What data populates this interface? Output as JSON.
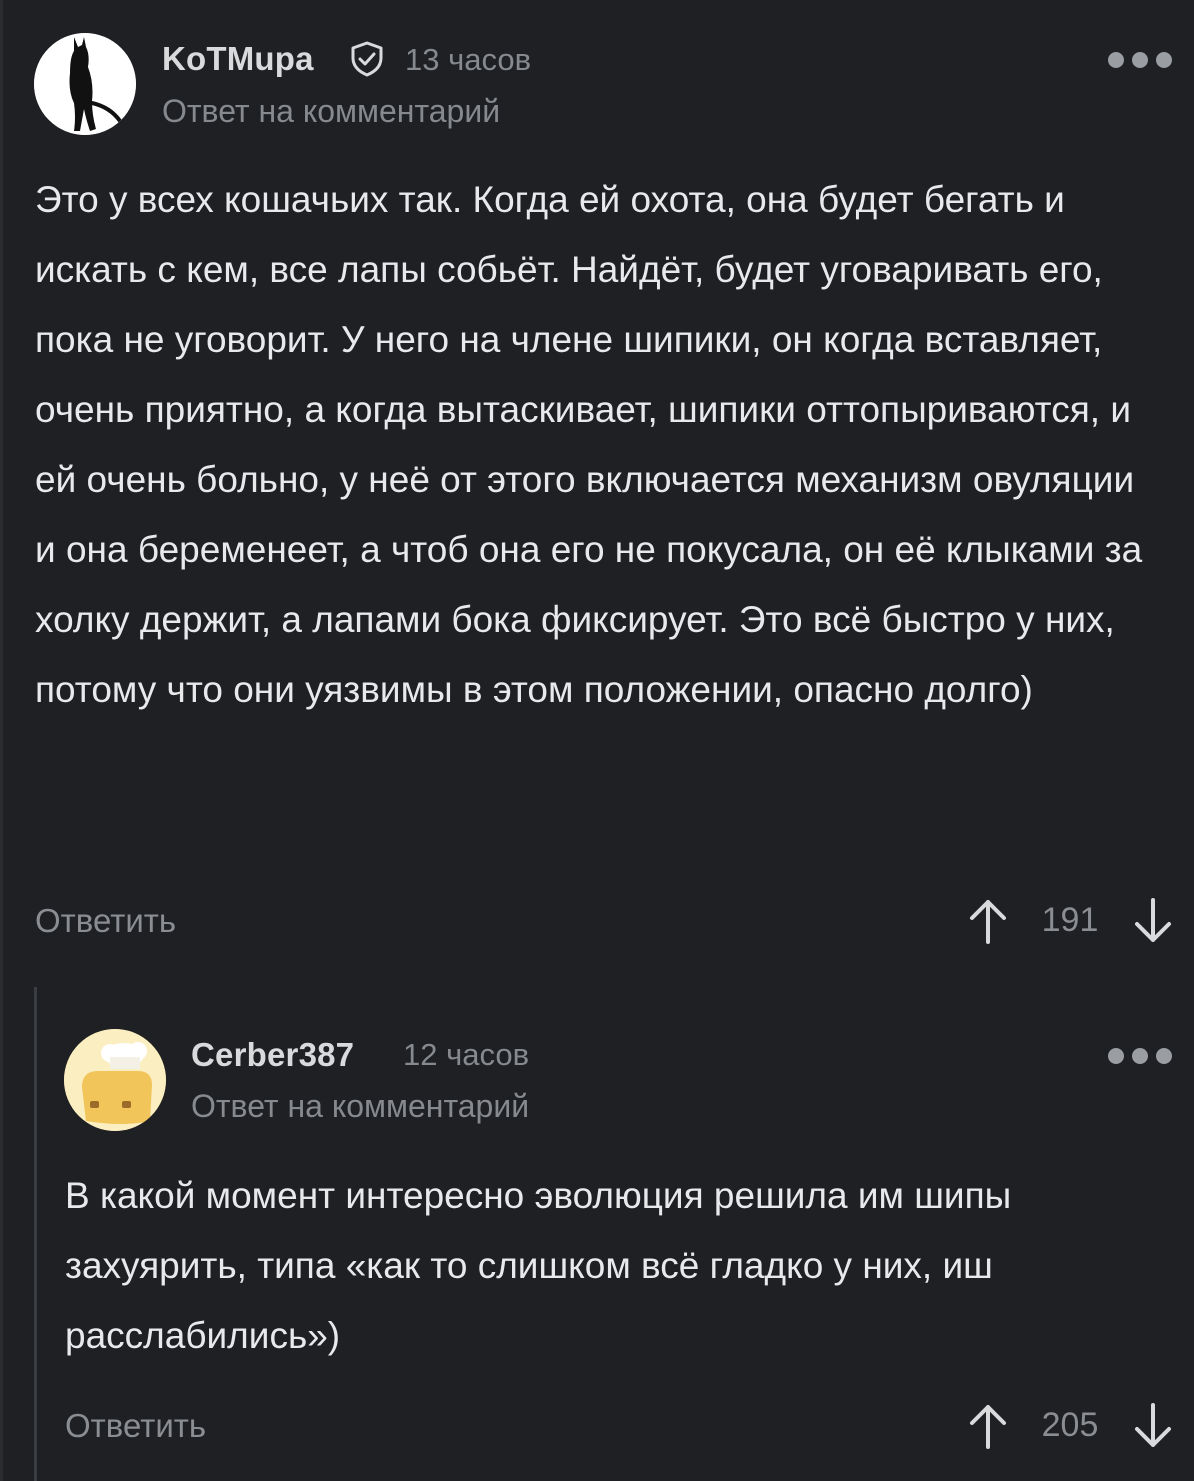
{
  "comments": [
    {
      "author": "KoTMupa",
      "time": "13 часов",
      "reply_note": "Ответ на комментарий",
      "body": "Это у всех кошачьих так. Когда ей охота, она будет бегать и искать с кем, все лапы собьёт. Найдёт, будет уговаривать его, пока не уговорит. У него на члене шипики, он когда вставляет, очень приятно, а когда вытаскивает, шипики оттопыриваются, и ей очень больно, у неё от этого включается механизм овуляции и она беременеет, а чтоб она его не покусала, он её клыками за холку держит, а лапами бока фиксирует. Это всё быстро у них, потому что они уязвимы в этом положении, опасно долго)",
      "reply_label": "Ответить",
      "score": "191"
    },
    {
      "author": "Cerber387",
      "time": "12 часов",
      "reply_note": "Ответ на комментарий",
      "body": "В какой момент интересно эволюция решила им шипы захуярить, типа «как то слишком всё гладко у них, иш расслабились»)",
      "reply_label": "Ответить",
      "score": "205"
    }
  ],
  "icons": {
    "verified": "shield-check-icon",
    "more": "more-dots-icon",
    "upvote": "arrow-up-icon",
    "downvote": "arrow-down-icon"
  },
  "colors": {
    "background": "#1e2023",
    "text": "#e8e9eb",
    "muted": "#86898e",
    "thread_line": "#3a3d42"
  }
}
